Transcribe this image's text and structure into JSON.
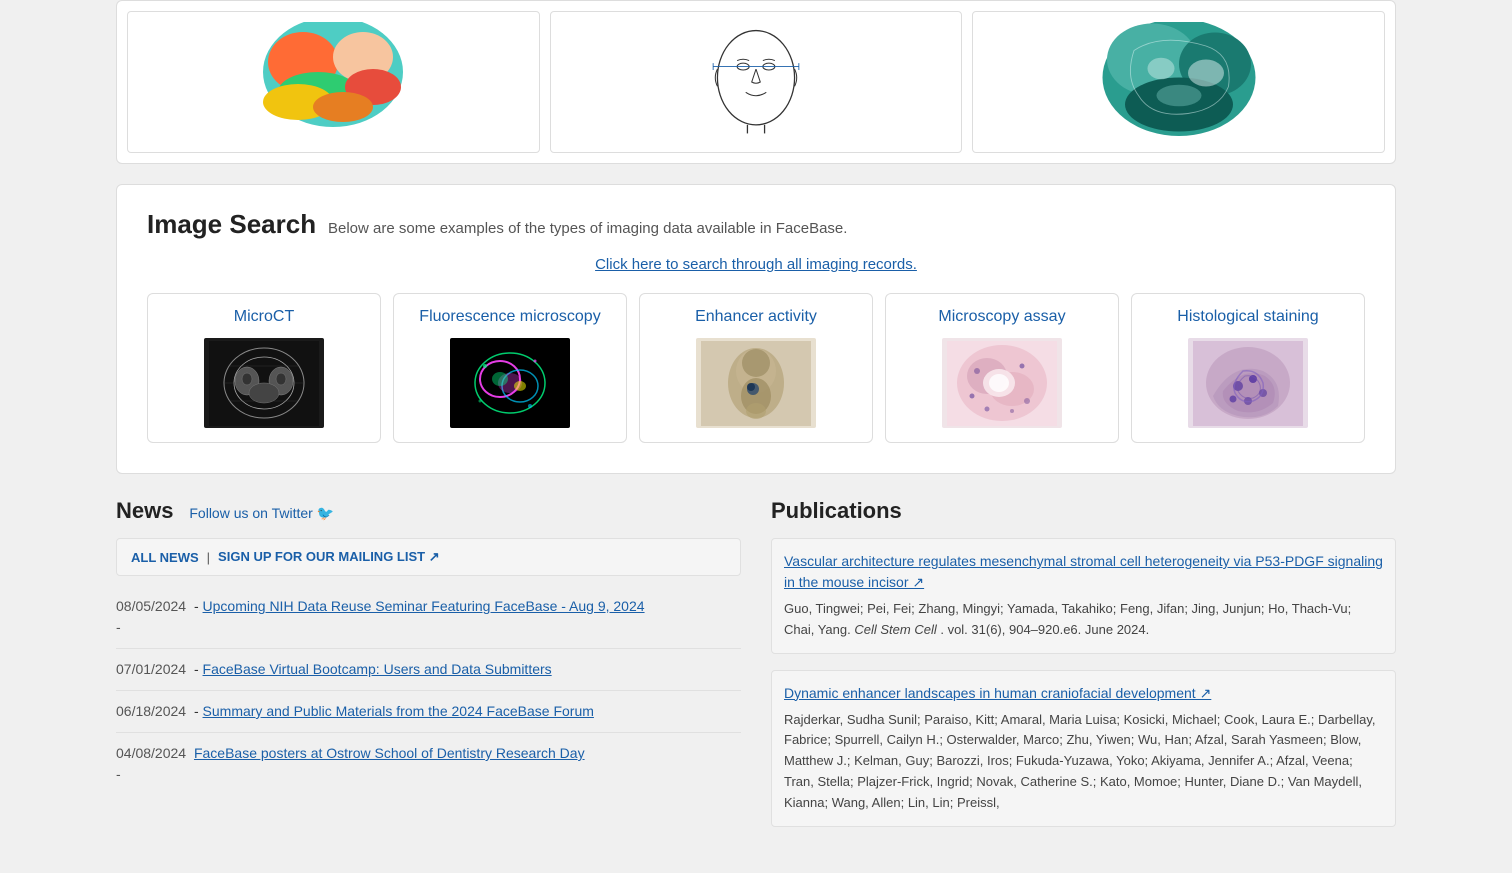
{
  "top_section": {
    "cards": [
      {
        "alt": "Colorful skull 3D model"
      },
      {
        "alt": "Face outline measurement diagram"
      },
      {
        "alt": "Teal skull CT scan"
      }
    ]
  },
  "image_search": {
    "title": "Image Search",
    "subtitle": "Below are some examples of the types of imaging data available in FaceBase.",
    "search_link": "Click here to search through all imaging records.",
    "cards": [
      {
        "title": "MicroCT",
        "alt": "MicroCT scan image"
      },
      {
        "title": "Fluorescence microscopy",
        "alt": "Fluorescence microscopy image"
      },
      {
        "title": "Enhancer activity",
        "alt": "Enhancer activity image"
      },
      {
        "title": "Microscopy assay",
        "alt": "Microscopy assay image"
      },
      {
        "title": "Histological staining",
        "alt": "Histological staining image"
      }
    ]
  },
  "news": {
    "title": "News",
    "twitter_link": "Follow us on Twitter 🐦",
    "all_news_label": "ALL NEWS",
    "mailing_list_label": "SIGN UP FOR OUR MAILING LIST ↗",
    "items": [
      {
        "date": "08/05/2024",
        "title": "Upcoming NIH Data Reuse Seminar Featuring FaceBase - Aug 9, 2024",
        "dash": "-"
      },
      {
        "date": "07/01/2024",
        "title": "FaceBase Virtual Bootcamp: Users and Data Submitters",
        "dash": ""
      },
      {
        "date": "06/18/2024",
        "title": "Summary and Public Materials from the 2024 FaceBase Forum",
        "dash": ""
      },
      {
        "date": "04/08/2024",
        "title": "FaceBase posters at Ostrow School of Dentistry Research Day",
        "dash": "-"
      }
    ]
  },
  "publications": {
    "title": "Publications",
    "items": [
      {
        "title": "Vascular architecture regulates mesenchymal stromal cell heterogeneity via P53-PDGF signaling in the mouse incisor ↗",
        "authors": "Guo, Tingwei; Pei, Fei; Zhang, Mingyi; Yamada, Takahiko; Feng, Jifan; Jing, Junjun; Ho, Thach-Vu; Chai, Yang.",
        "journal": "Cell Stem Cell",
        "citation": ". vol. 31(6), 904–920.e6. June 2024."
      },
      {
        "title": "Dynamic enhancer landscapes in human craniofacial development ↗",
        "authors": "Rajderkar, Sudha Sunil; Paraiso, Kitt; Amaral, Maria Luisa; Kosicki, Michael; Cook, Laura E.; Darbellay, Fabrice; Spurrell, Cailyn H.; Osterwalder, Marco; Zhu, Yiwen; Wu, Han; Afzal, Sarah Yasmeen; Blow, Matthew J.; Kelman, Guy; Barozzi, Iros; Fukuda-Yuzawa, Yoko; Akiyama, Jennifer A.; Afzal, Veena; Tran, Stella; Plajzer-Frick, Ingrid; Novak, Catherine S.; Kato, Momoe; Hunter, Diane D.; Van Maydell, Kianna; Wang, Allen; Lin, Lin; Preissl,",
        "journal": "",
        "citation": ""
      }
    ]
  }
}
